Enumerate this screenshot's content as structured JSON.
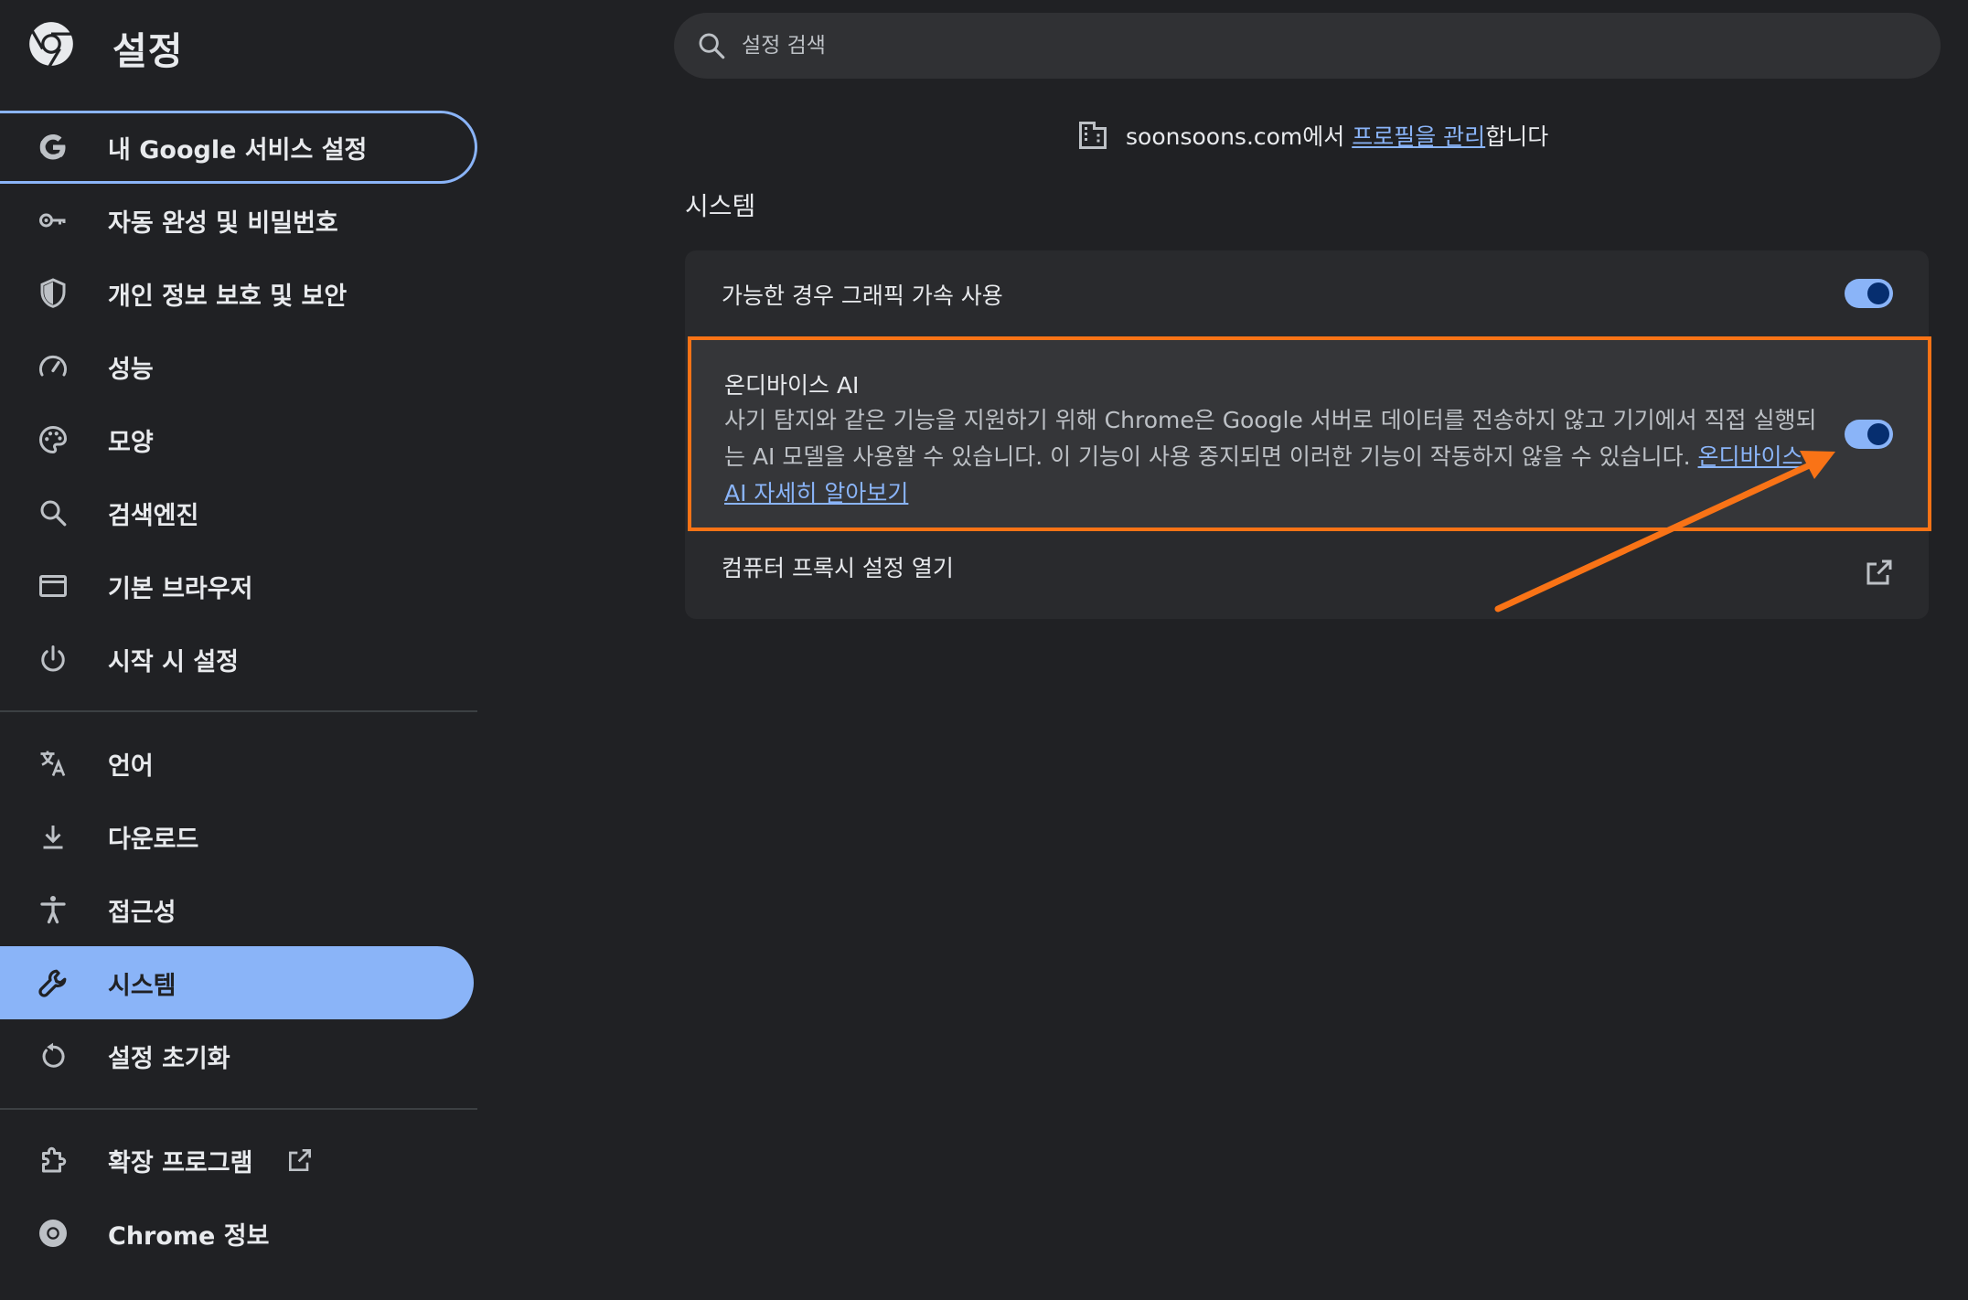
{
  "header": {
    "title": "설정",
    "search_placeholder": "설정 검색"
  },
  "sidebar": {
    "items": [
      {
        "label": "내 Google 서비스 설정",
        "icon": "google-g-icon",
        "state": "focused"
      },
      {
        "label": "자동 완성 및 비밀번호",
        "icon": "key-icon"
      },
      {
        "label": "개인 정보 보호 및 보안",
        "icon": "shield-icon"
      },
      {
        "label": "성능",
        "icon": "speedometer-icon"
      },
      {
        "label": "모양",
        "icon": "palette-icon"
      },
      {
        "label": "검색엔진",
        "icon": "search-icon"
      },
      {
        "label": "기본 브라우저",
        "icon": "browser-window-icon"
      },
      {
        "label": "시작 시 설정",
        "icon": "power-icon"
      },
      {
        "label": "언어",
        "icon": "translate-icon"
      },
      {
        "label": "다운로드",
        "icon": "download-icon"
      },
      {
        "label": "접근성",
        "icon": "accessibility-icon"
      },
      {
        "label": "시스템",
        "icon": "wrench-icon",
        "state": "active"
      },
      {
        "label": "설정 초기화",
        "icon": "reset-icon"
      },
      {
        "label": "확장 프로그램",
        "icon": "extension-icon",
        "external": true
      },
      {
        "label": "Chrome 정보",
        "icon": "chrome-icon"
      }
    ]
  },
  "main": {
    "managed_prefix": "soonsoons.com에서 ",
    "managed_link": "프로필을 관리",
    "managed_suffix": "합니다",
    "section_title": "시스템",
    "gpu_label": "가능한 경우 그래픽 가속 사용",
    "gpu_enabled": true,
    "ai_title": "온디바이스 AI",
    "ai_description": "사기 탐지와 같은 기능을 지원하기 위해 Chrome은 Google 서버로 데이터를 전송하지 않고 기기에서 직접 실행되는 AI 모델을 사용할 수 있습니다. 이 기능이 사용 중지되면 이러한 기능이 작동하지 않을 수 있습니다. ",
    "ai_learn_more": "온디바이스 AI 자세히 알아보기",
    "ai_enabled": true,
    "proxy_label": "컴퓨터 프록시 설정 열기"
  },
  "colors": {
    "background": "#202124",
    "accent": "#8ab4f8",
    "annotation": "#f97316"
  }
}
